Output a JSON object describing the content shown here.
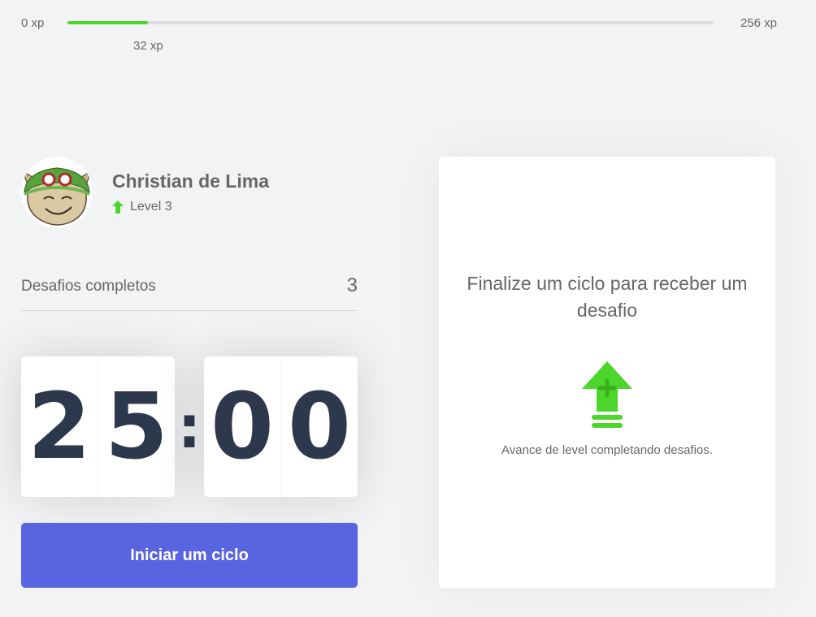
{
  "xp": {
    "min_label": "0 xp",
    "max_label": "256 xp",
    "current_label": "32 xp",
    "current": 32,
    "max": 256,
    "progress_color": "#4cd62b"
  },
  "profile": {
    "name": "Christian de Lima",
    "level_label": "Level 3",
    "avatar_icon": "avatar-image",
    "level_icon": "level-up-arrow-icon"
  },
  "completed_challenges": {
    "label": "Desafios completos",
    "count": "3"
  },
  "countdown": {
    "minute_left": "2",
    "minute_right": "5",
    "separator": ":",
    "second_left": "0",
    "second_right": "0"
  },
  "start_button": {
    "label": "Iniciar um ciclo",
    "color": "#5965e0"
  },
  "challenge_box": {
    "title": "Finalize um ciclo para receber um desafio",
    "description": "Avance de level completando desafios.",
    "icon": "level-up-icon"
  }
}
